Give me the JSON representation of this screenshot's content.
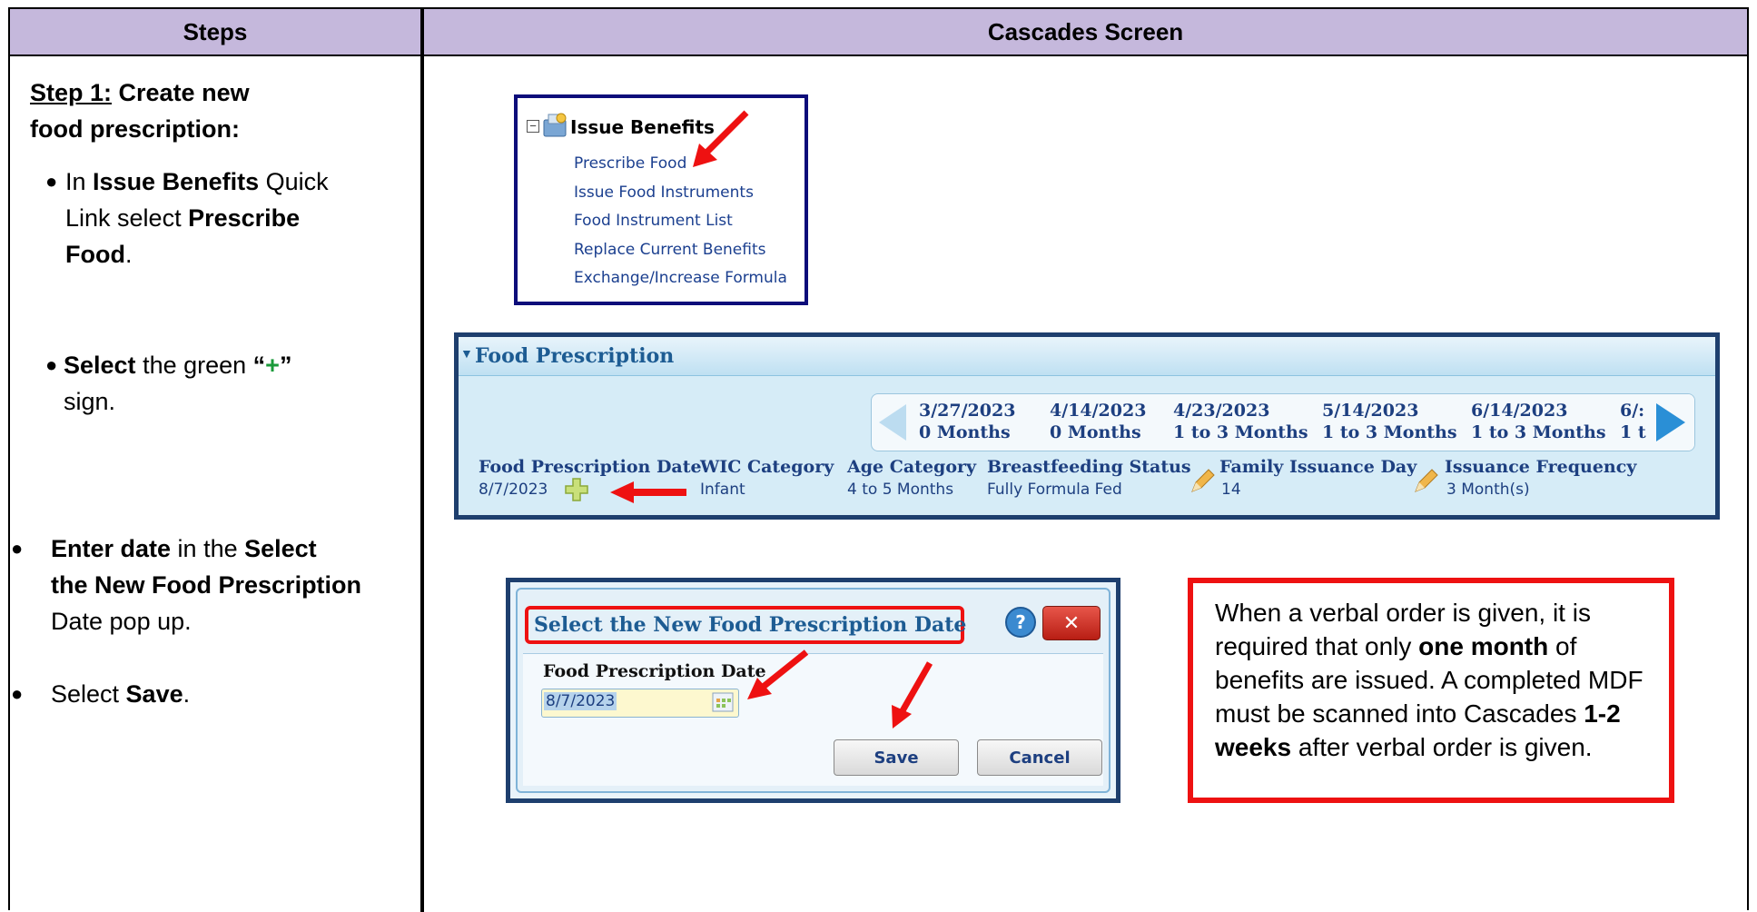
{
  "header": {
    "steps_label": "Steps",
    "screen_label": "Cascades Screen"
  },
  "step1": {
    "title_prefix": "Step 1:",
    "title_rest_line1": " Create new",
    "title_line2": "food prescription:",
    "b1": {
      "t1": "In ",
      "t2": "Issue Benefits",
      "t3": " Quick",
      "t4": "Link  select ",
      "t5": "Prescribe",
      "t6": "Food",
      "t7": "."
    },
    "b2": {
      "t1": "Select",
      "t2": " the green ",
      "t3": "“",
      "t4": "+",
      "t5": "”",
      "t6": "sign."
    },
    "b3": {
      "t1": "Enter date",
      "t2": " in the ",
      "t3": "Select",
      "t4": "the New Food Prescription",
      "t5": "Date pop up."
    },
    "b4": {
      "t1": "Select ",
      "t2": "Save",
      "t3": "."
    }
  },
  "issue_benefits": {
    "title": "Issue Benefits",
    "links": [
      "Prescribe Food",
      "Issue Food Instruments",
      "Food Instrument List",
      "Replace Current Benefits",
      "Exchange/Increase Formula"
    ]
  },
  "food_prescription": {
    "title": "Food Prescription",
    "dates": [
      {
        "date": "3/27/2023",
        "range": "0 Months"
      },
      {
        "date": "4/14/2023",
        "range": "0 Months"
      },
      {
        "date": "4/23/2023",
        "range": "1 to 3 Months"
      },
      {
        "date": "5/14/2023",
        "range": "1 to 3 Months"
      },
      {
        "date": "6/14/2023",
        "range": "1 to 3 Months"
      },
      {
        "date": "6/:",
        "range": "1 t"
      }
    ],
    "labels": {
      "date": "Food Prescription Date",
      "wic": "WIC Category",
      "age": "Age Category",
      "breast": "Breastfeeding Status",
      "family": "Family Issuance Day",
      "freq": "Issuance Frequency"
    },
    "values": {
      "date": "8/7/2023",
      "wic": "Infant",
      "age": "4 to 5 Months",
      "breast": "Fully Formula Fed",
      "family": "14",
      "freq": "3  Month(s)"
    }
  },
  "dialog": {
    "title": "Select the New Food Prescription Date",
    "field_label": "Food Prescription Date",
    "field_value": "8/7/2023",
    "save": "Save",
    "cancel": "Cancel"
  },
  "note": {
    "t1": "When a verbal order is given, it is required that only ",
    "t2": "one month",
    "t3": " of benefits are issued. A completed MDF must be scanned into Cascades ",
    "t4": "1-2 weeks",
    "t5": " after verbal order is given."
  },
  "colors": {
    "header_bg": "#c5b8dc",
    "arrow": "#ee1111",
    "plus": "#1a9a3a"
  }
}
